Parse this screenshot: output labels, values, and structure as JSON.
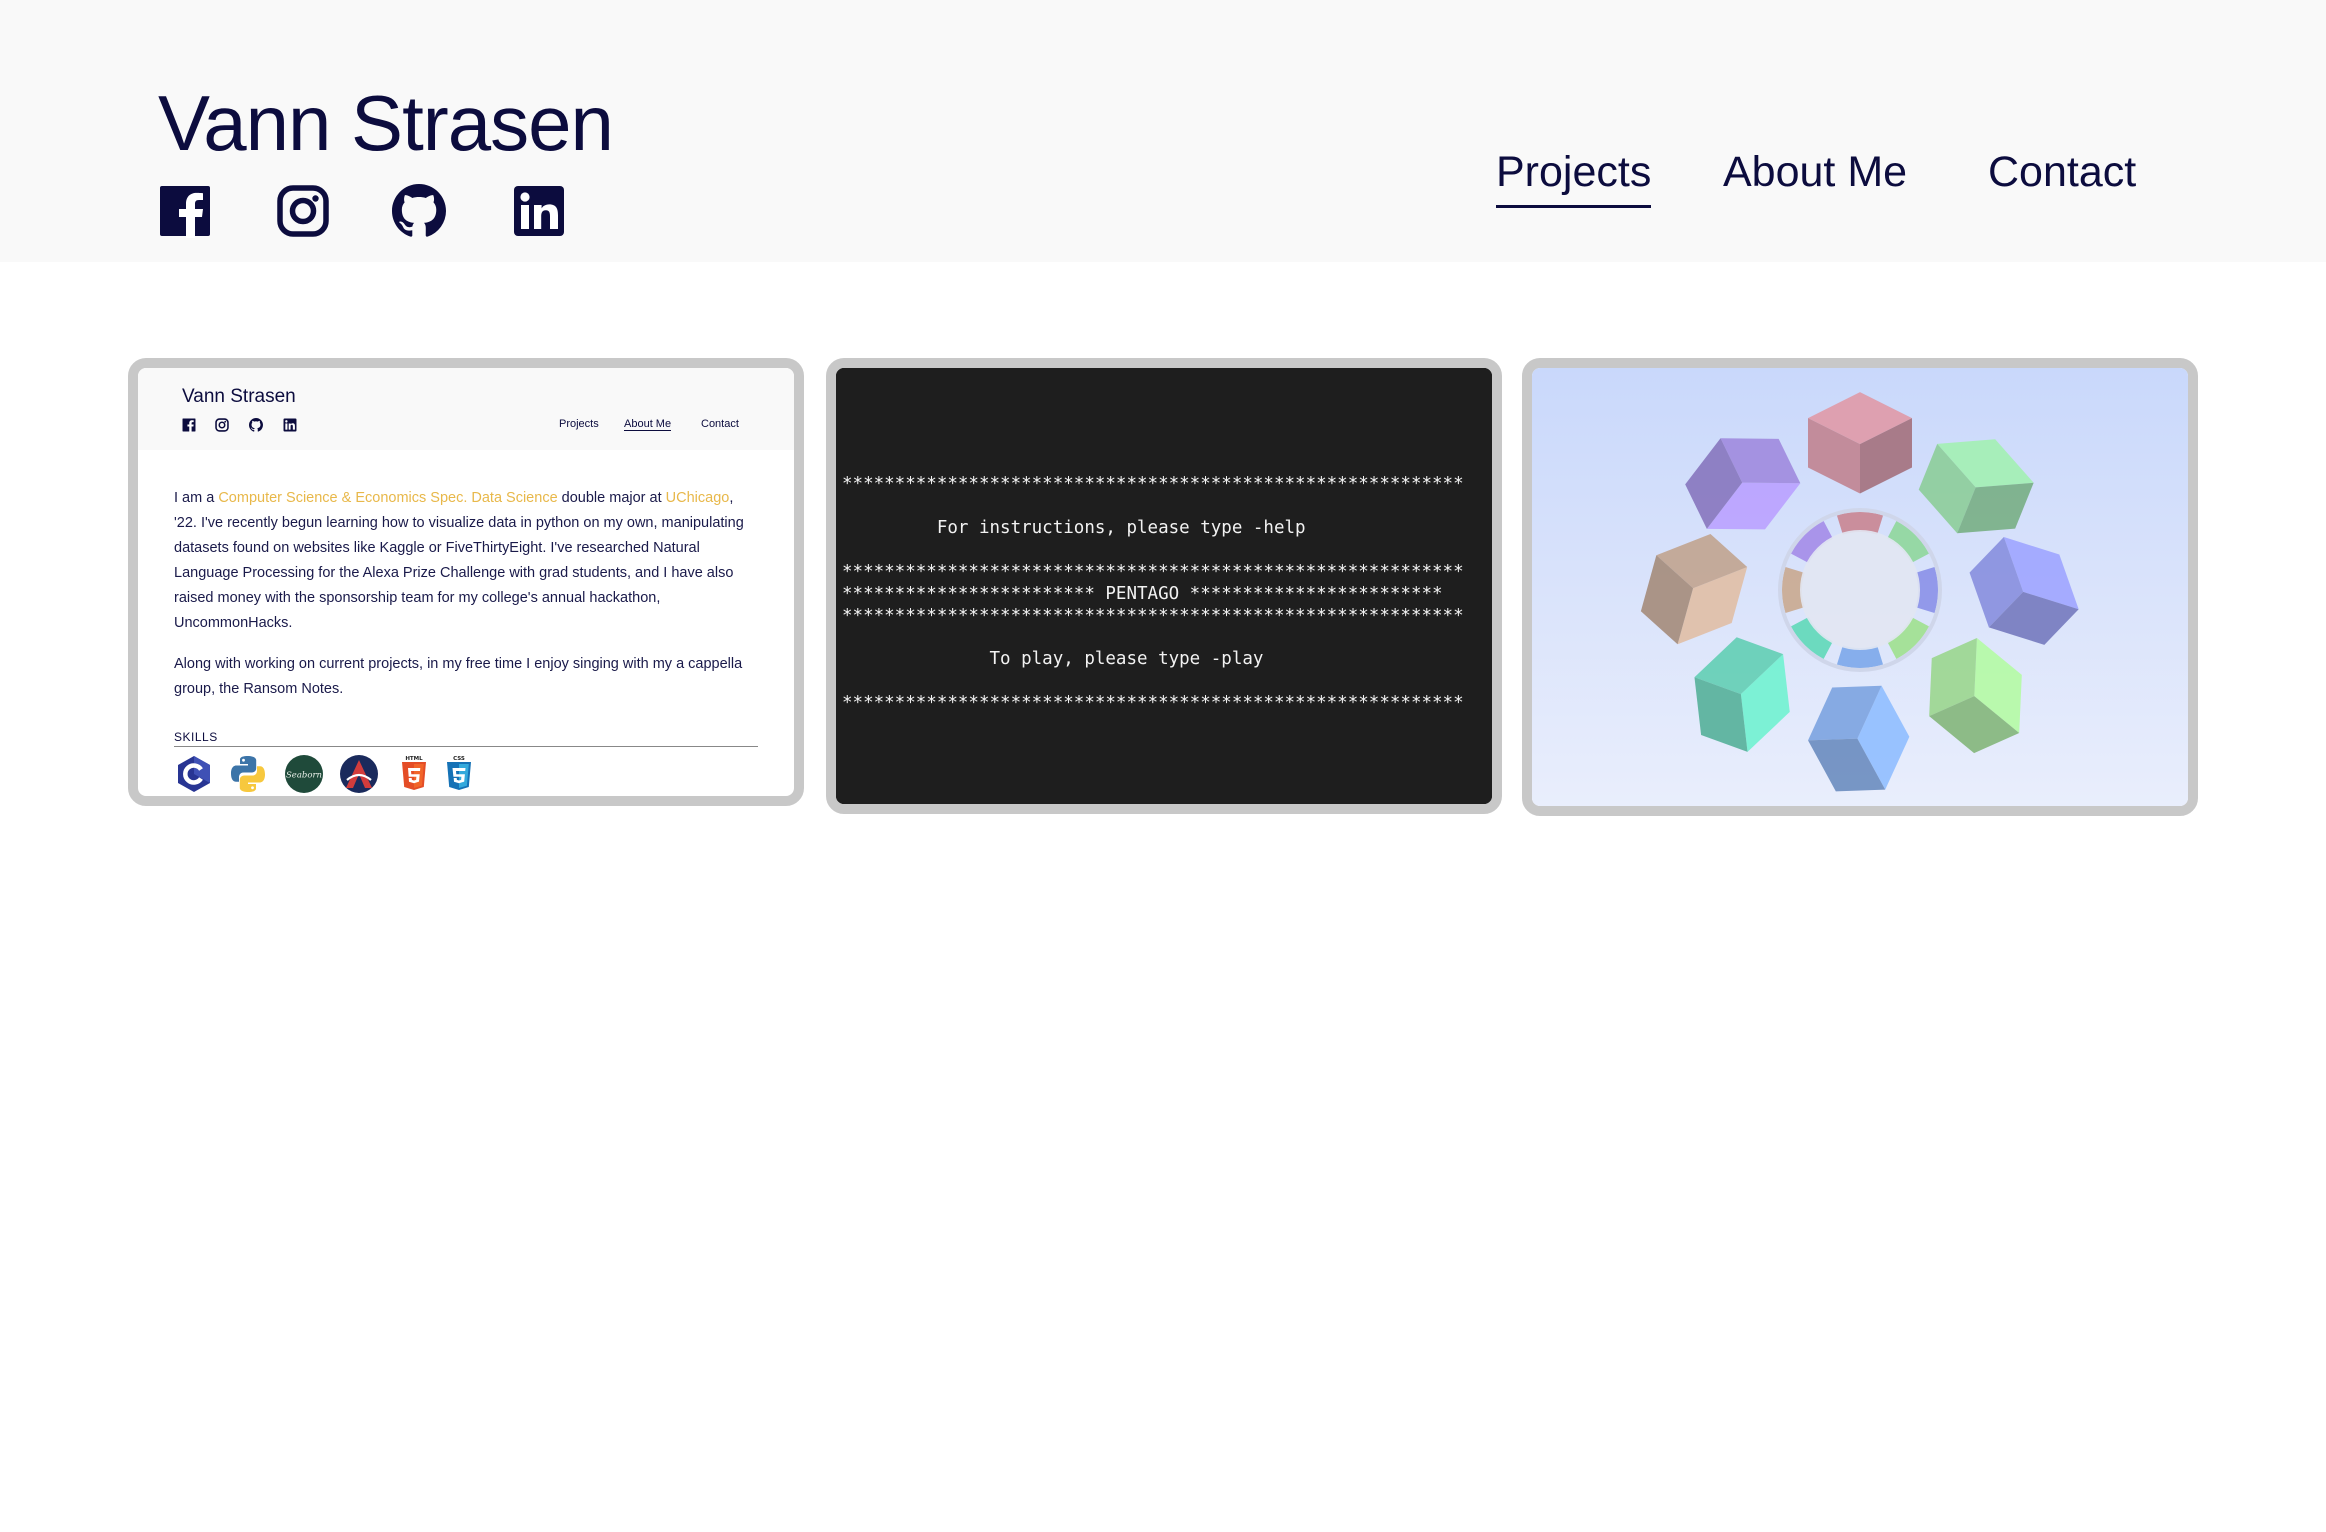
{
  "header": {
    "site_name": "Vann Strasen",
    "socials": [
      "facebook-icon",
      "instagram-icon",
      "github-icon",
      "linkedin-icon"
    ],
    "nav": {
      "projects": "Projects",
      "about": "About Me",
      "contact": "Contact",
      "active": "Projects"
    }
  },
  "projects": {
    "personal_site": {
      "site_name": "Vann Strasen",
      "nav": {
        "projects": "Projects",
        "about": "About Me",
        "contact": "Contact"
      },
      "para1_a": "I am a ",
      "para1_hl1": "Computer Science & Economics Spec. Data Science",
      "para1_b": " double major at ",
      "para1_hl2": "UChicago",
      "para1_c": ", '22. I've recently begun learning how to visualize data in python on my own, manipulating datasets found on websites like Kaggle or FiveThirtyEight. I've researched Natural Language Processing for the Alexa Prize Challenge with grad students, and I have also raised money with the sponsorship team for my college's annual hackathon, UncommonHacks.",
      "para2": "Along with working on current projects, in my free time I enjoy singing with my a cappella group, the Ransom Notes.",
      "skills_title": "SKILLS",
      "skills": [
        "c-icon",
        "python-icon",
        "seaborn-icon",
        "arch-icon",
        "html5-icon",
        "css3-icon"
      ],
      "seaborn_label": "Seaborn",
      "html_label": "HTML",
      "css_label": "CSS"
    },
    "pentago": {
      "stars": "***********************************************************",
      "help_line": "         For instructions, please type -help",
      "title_line": "************************ PENTAGO ************************",
      "play_line": "              To play, please type -play"
    },
    "cubes": {
      "colors": [
        "#c98591",
        "#8fd79b",
        "#8a90e8",
        "#9ee08e",
        "#7ca7ea",
        "#5fd8b8",
        "#c9a88f",
        "#a48ce8"
      ]
    }
  },
  "colors": {
    "text": "#0c0c3e",
    "header_bg": "#f9f9f9",
    "accent": "#e8b84a",
    "card_border": "#c8c8c8"
  }
}
